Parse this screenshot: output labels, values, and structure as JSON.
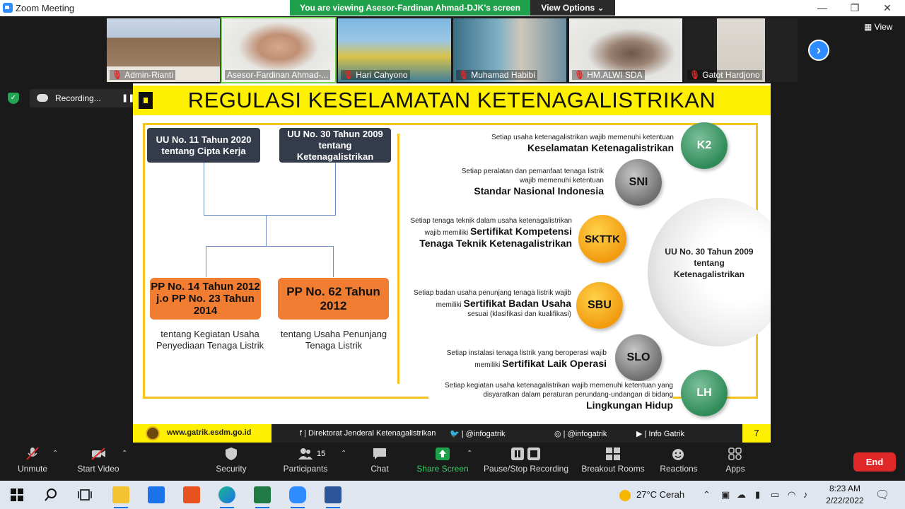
{
  "window": {
    "title": "Zoom Meeting",
    "viewing_banner": "You are viewing Asesor-Fardinan Ahmad-DJK's screen",
    "view_options": "View Options ⌄",
    "minimize": "—",
    "maximize": "❐",
    "close": "✕"
  },
  "gallery": {
    "view_label": "View",
    "next": "›",
    "participants": [
      {
        "name": "Admin-Rianti",
        "muted": "🎙"
      },
      {
        "name": "Asesor-Fardinan Ahmad-...",
        "muted": ""
      },
      {
        "name": "Hari Cahyono",
        "muted": "🎙"
      },
      {
        "name": "Muhamad Habibi",
        "muted": "🎙"
      },
      {
        "name": "HM.ALWI SDA",
        "muted": "🎙"
      },
      {
        "name": "Gatot Hardjono",
        "muted": "🎙"
      }
    ]
  },
  "recording": {
    "label": "Recording...",
    "pause": "❚❚"
  },
  "slide": {
    "title": "REGULASI KESELAMATAN KETENAGALISTRIKAN",
    "left": {
      "uu11": "UU No. 11 Tahun 2020 tentang Cipta Kerja",
      "uu30": "UU No. 30 Tahun 2009 tentang Ketenagalistrikan",
      "pp14": "PP No. 14 Tahun 2012 j.o PP No. 23 Tahun 2014",
      "pp62": "PP No. 62 Tahun 2012",
      "pp14_desc": "tentang Kegiatan Usaha Penyediaan Tenaga Listrik",
      "pp62_desc": "tentang Usaha Penunjang Tenaga Listrik"
    },
    "right": {
      "k2_text": "Setiap usaha ketenagalistrikan wajib memenuhi ketentuan",
      "k2_bold": "Keselamatan Ketenagalistrikan",
      "sni_text": "Setiap peralatan dan pemanfaat tenaga listrik wajib memenuhi ketentuan",
      "sni_bold": "Standar Nasional Indonesia",
      "skttk_text": "Setiap tenaga teknik dalam usaha ketenagalistrikan wajib memiliki",
      "skttk_bold": "Sertifikat Kompetensi Tenaga Teknik Ketenagalistrikan",
      "sbu_text": "Setiap badan usaha penunjang tenaga listrik wajib memiliki",
      "sbu_bold": "Sertifikat Badan Usaha",
      "sbu_tail": "sesuai (klasifikasi dan kualifikasi)",
      "slo_text": "Setiap instalasi tenaga listrik yang beroperasi wajib memiliki",
      "slo_bold": "Sertifikat Laik Operasi",
      "lh_text": "Setiap kegiatan usaha ketenagalistrikan wajib memenuhi ketentuan yang disyaratkan dalam peraturan perundang-undangan di bidang",
      "lh_bold": "Lingkungan Hidup",
      "center": "UU No. 30 Tahun 2009 tentang Ketenagalistrikan",
      "circles": {
        "k2": "K2",
        "sni": "SNI",
        "skttk": "SKTTK",
        "sbu": "SBU",
        "slo": "SLO",
        "lh": "LH"
      }
    },
    "footer": {
      "site": "www.gatrik.esdm.go.id",
      "fb": "f | Direktorat Jenderal Ketenagalistrikan",
      "tw": "🐦 | @infogatrik",
      "ig": "◎ | @infogatrik",
      "yt": "▶ | Info Gatrik",
      "page": "7"
    }
  },
  "toolbar": {
    "unmute": "Unmute",
    "start_video": "Start Video",
    "security": "Security",
    "participants": "Participants",
    "participants_count": "15",
    "chat": "Chat",
    "share_screen": "Share Screen",
    "pause_recording": "Pause/Stop Recording",
    "breakout": "Breakout Rooms",
    "reactions": "Reactions",
    "apps": "Apps",
    "end": "End"
  },
  "taskbar": {
    "weather": "27°C Cerah",
    "time": "8:23 AM",
    "date": "2/22/2022"
  },
  "colors": {
    "zoom_blue": "#2d8cff",
    "banner_green": "#1fa04a",
    "slide_yellow": "#ffef00",
    "end_red": "#e02828"
  }
}
